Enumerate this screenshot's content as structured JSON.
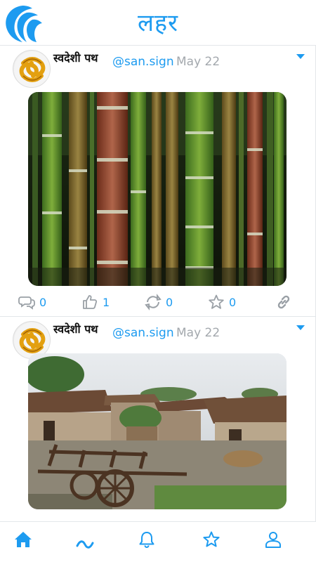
{
  "app": {
    "title": "लहर",
    "accent": "#1d9bf0"
  },
  "posts": [
    {
      "author": "स्वदेशी पथ",
      "handle": "@san.sign",
      "date": "May 22",
      "media": "bamboo-grove-photo",
      "counts": {
        "replies": "0",
        "likes": "1",
        "reposts": "0",
        "stars": "0"
      }
    },
    {
      "author": "स्वदेशी पथ",
      "handle": "@san.sign",
      "date": "May 22",
      "media": "village-bullock-cart-photo"
    }
  ],
  "nav": {
    "items": [
      "home-icon",
      "wave-icon",
      "bell-icon",
      "star-icon",
      "user-icon"
    ]
  }
}
